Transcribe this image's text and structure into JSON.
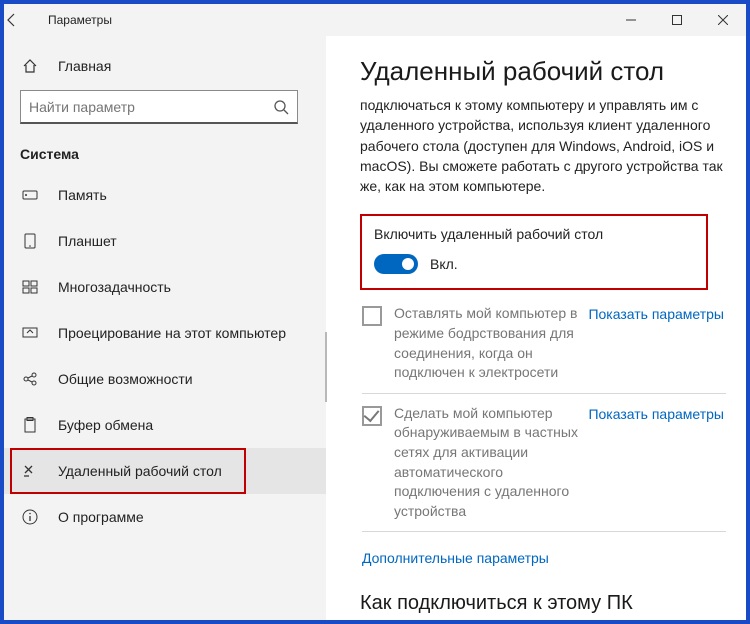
{
  "titlebar": {
    "title": "Параметры"
  },
  "sidebar": {
    "home": "Главная",
    "search_placeholder": "Найти параметр",
    "section": "Система",
    "items": [
      {
        "label": "Память"
      },
      {
        "label": "Планшет"
      },
      {
        "label": "Многозадачность"
      },
      {
        "label": "Проецирование на этот компьютер"
      },
      {
        "label": "Общие возможности"
      },
      {
        "label": "Буфер обмена"
      },
      {
        "label": "Удаленный рабочий стол"
      },
      {
        "label": "О программе"
      }
    ]
  },
  "content": {
    "title": "Удаленный рабочий стол",
    "desc": "подключаться к этому компьютеру и управлять им с удаленного устройства, используя клиент удаленного рабочего стола (доступен для Windows, Android, iOS и macOS). Вы сможете работать с другого устройства так же, как на этом компьютере.",
    "toggle_label": "Включить удаленный рабочий стол",
    "toggle_state": "Вкл.",
    "opt1": "Оставлять мой компьютер в режиме бодрствования для соединения, когда он подключен к электросети",
    "opt2": "Сделать мой компьютер обнаруживаемым в частных сетях для активации автоматического подключения с удаленного устройства",
    "show_params": "Показать параметры",
    "extra": "Дополнительные параметры",
    "subheading": "Как подключиться к этому ПК"
  }
}
